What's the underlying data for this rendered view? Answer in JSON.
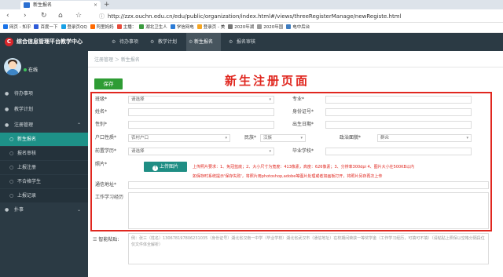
{
  "browser": {
    "tab_title": "新生报名",
    "tab_close": "×",
    "new_tab": "+",
    "url_host": "http://zzx.ouchn.edu.cn",
    "url_path": "/edu/public/organization/index.html#/views/threeRegisterManage/newRegiste.html",
    "back": "‹",
    "forward": "›",
    "reload": "↻",
    "home": "⌂",
    "bookmarks": [
      {
        "label": "网页 - 知乎",
        "color": "#1a73e8"
      },
      {
        "label": "百度一下",
        "color": "#2e5bd8"
      },
      {
        "label": "登录页QQ",
        "color": "#19a1e6"
      },
      {
        "label": "阿里妈妈",
        "color": "#ff6a00"
      },
      {
        "label": "主播：",
        "color": "#e74c3c"
      },
      {
        "label": "湖北卫生人",
        "color": "#3b9b3f"
      },
      {
        "label": "学信网电",
        "color": "#2b7bd6"
      },
      {
        "label": "登录页 - 美",
        "color": "#f5a623"
      },
      {
        "label": "2020年湖",
        "color": "#777777"
      },
      {
        "label": "2020年国",
        "color": "#999999"
      },
      {
        "label": "电中后台",
        "color": "#3f7dc0"
      }
    ]
  },
  "app": {
    "title": "综合信息管理平台教学中心",
    "logo_char": "C",
    "nav": [
      {
        "label": "待办事项",
        "icon": "gear-icon"
      },
      {
        "label": "教学计划",
        "icon": "gear-icon"
      },
      {
        "label": "新生报名",
        "icon": "gear-icon"
      },
      {
        "label": "报名审核",
        "icon": "gear-icon"
      }
    ]
  },
  "sidebar": {
    "status": "在线",
    "items": [
      {
        "label": "待办事项",
        "icon": "●"
      },
      {
        "label": "教学计划",
        "icon": "●"
      },
      {
        "label": "注册管理",
        "icon": "●"
      },
      {
        "label": "新生报名",
        "icon": "○"
      },
      {
        "label": "报名审核",
        "icon": "○"
      },
      {
        "label": "上报注册",
        "icon": "○"
      },
      {
        "label": "不合格学生",
        "icon": "○"
      },
      {
        "label": "上报记录",
        "icon": "○"
      },
      {
        "label": "扑事",
        "icon": "●"
      }
    ]
  },
  "main": {
    "breadcrumb": "注册管理  ＞  新生报名",
    "save": "保存",
    "annotation": "新生注册页面",
    "form": {
      "class_label": "班级*",
      "class_value": "请选择",
      "major_label": "专业*",
      "name_label": "姓名*",
      "id_label": "身份证号*",
      "gender_label": "性别*",
      "birth_label": "出生日期*",
      "hukou_label": "户口性质*",
      "hukou_value": "农村户口",
      "ethnic_label": "民族*",
      "ethnic_value": "汉族",
      "political_label": "政治面貌*",
      "political_value": "群众",
      "edu_label": "前置学历*",
      "edu_value": "请选择",
      "grad_label": "毕业学校*",
      "photo_label": "照片*",
      "upload": "上传图片",
      "photo_note_1": "上传照片要求：1、免冠蓝底；2、大小尺寸为宽度：413像素，高度：626像素；3、分辨率300dpi 4、图片大小在500KB以内",
      "photo_note_2": "如保存时系统提示'保存失败'，将照片用photoshop,adobe等图片处理或者如画板打开，将照片另存再次上传",
      "address_label": "通信地址*",
      "experience_label": "工作学习经历",
      "smart_label": "智能粘贴:",
      "smart_placeholder": "例：张三（姓名）130678197806231035（身份证号）湖北省汉南一中学（毕业学校）湖北省武汉市（通信地址）在校期间荣获一等奖学金（工作学习经历，可填可不填）（请粘贴上照保以空格分隔段位仅文件体全解析）"
    }
  }
}
